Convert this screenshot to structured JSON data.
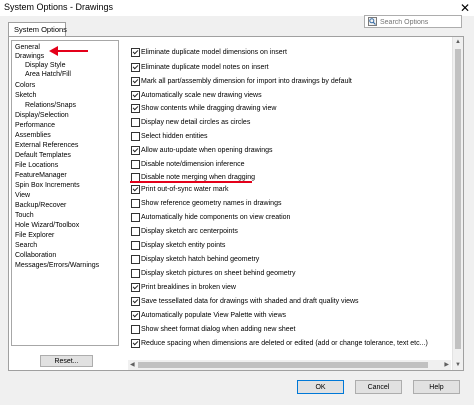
{
  "window": {
    "title": "System Options - Drawings",
    "close_glyph": "✕"
  },
  "tab": {
    "label": "System Options"
  },
  "search": {
    "placeholder": "Search Options"
  },
  "tree": [
    {
      "label": "General",
      "level": 0
    },
    {
      "label": "Drawings",
      "level": 0
    },
    {
      "label": "Display Style",
      "level": 1
    },
    {
      "label": "Area Hatch/Fill",
      "level": 1
    },
    {
      "label": "Colors",
      "level": 0
    },
    {
      "label": "Sketch",
      "level": 0
    },
    {
      "label": "Relations/Snaps",
      "level": 1
    },
    {
      "label": "Display/Selection",
      "level": 0
    },
    {
      "label": "Performance",
      "level": 0
    },
    {
      "label": "Assemblies",
      "level": 0
    },
    {
      "label": "External References",
      "level": 0
    },
    {
      "label": "Default Templates",
      "level": 0
    },
    {
      "label": "File Locations",
      "level": 0
    },
    {
      "label": "FeatureManager",
      "level": 0
    },
    {
      "label": "Spin Box Increments",
      "level": 0
    },
    {
      "label": "View",
      "level": 0
    },
    {
      "label": "Backup/Recover",
      "level": 0
    },
    {
      "label": "Touch",
      "level": 0
    },
    {
      "label": "Hole Wizard/Toolbox",
      "level": 0
    },
    {
      "label": "File Explorer",
      "level": 0
    },
    {
      "label": "Search",
      "level": 0
    },
    {
      "label": "Collaboration",
      "level": 0
    },
    {
      "label": "Messages/Errors/Warnings",
      "level": 0
    }
  ],
  "options": [
    {
      "label": "Eliminate duplicate model dimensions on insert",
      "checked": true
    },
    {
      "label": "Eliminate duplicate model notes on insert",
      "checked": true
    },
    {
      "label": "Mark all part/assembly dimension for import into drawings by default",
      "checked": true
    },
    {
      "label": "Automatically scale new drawing views",
      "checked": true
    },
    {
      "label": "Show contents while dragging drawing view",
      "checked": true
    },
    {
      "label": "Display new detail circles as circles",
      "checked": false
    },
    {
      "label": "Select hidden entities",
      "checked": false
    },
    {
      "label": "Allow auto-update when opening drawings",
      "checked": true
    },
    {
      "label": "Disable note/dimension inference",
      "checked": false
    },
    {
      "label": "Disable note merging when dragging",
      "checked": false
    },
    {
      "label": "Print out-of-sync water mark",
      "checked": true
    },
    {
      "label": "Show reference geometry names in drawings",
      "checked": false
    },
    {
      "label": "Automatically hide components on view creation",
      "checked": false
    },
    {
      "label": "Display sketch arc centerpoints",
      "checked": false
    },
    {
      "label": "Display sketch entity points",
      "checked": false
    },
    {
      "label": "Display sketch hatch behind geometry",
      "checked": false
    },
    {
      "label": "Display sketch pictures on sheet behind geometry",
      "checked": false
    },
    {
      "label": "Print breaklines in broken view",
      "checked": true
    },
    {
      "label": "Save tessellated data for drawings with shaded and draft quality views",
      "checked": true
    },
    {
      "label": "Automatically populate View Palette with views",
      "checked": true
    },
    {
      "label": "Show sheet format dialog when adding new sheet",
      "checked": false
    },
    {
      "label": "Reduce spacing when dimensions are deleted or edited (add or change tolerance, text etc...)",
      "checked": true
    }
  ],
  "buttons": {
    "reset": "Reset...",
    "ok": "OK",
    "cancel": "Cancel",
    "help": "Help"
  },
  "colors": {
    "annotation_red": "#e4001a",
    "accent": "#0078d7"
  }
}
